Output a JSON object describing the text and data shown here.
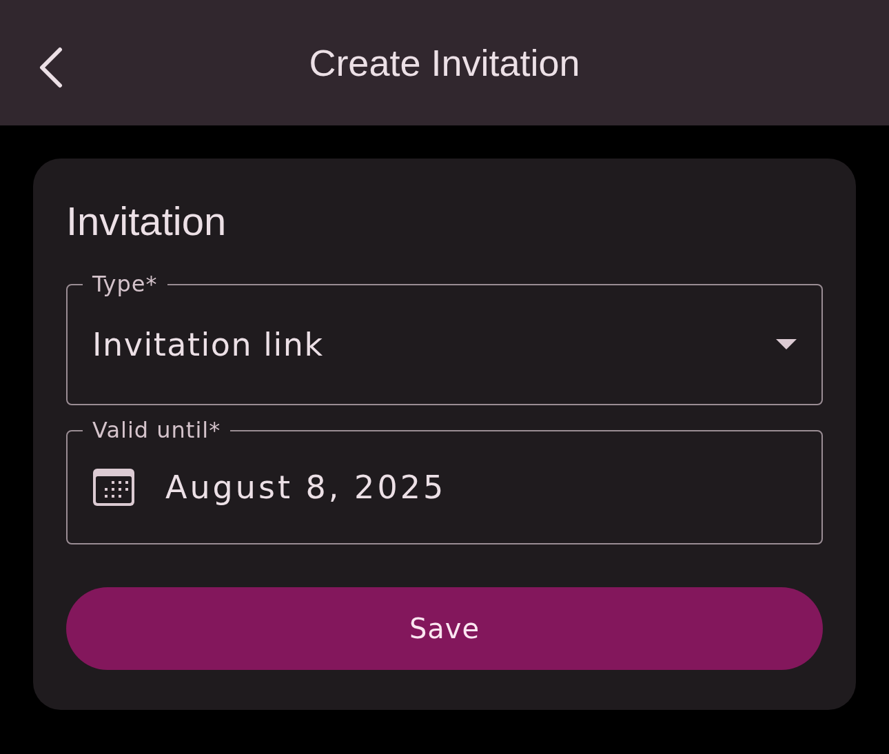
{
  "app_bar": {
    "title": "Create Invitation"
  },
  "card": {
    "title": "Invitation",
    "fields": [
      {
        "kind": "dropdown",
        "label": "Type*",
        "value": "Invitation link"
      },
      {
        "kind": "date",
        "label": "Valid until*",
        "value": "August 8, 2025"
      }
    ],
    "save_button": "Save"
  }
}
